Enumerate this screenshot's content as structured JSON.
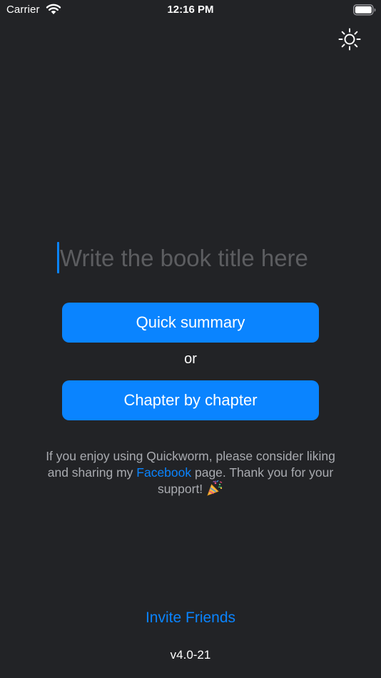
{
  "status_bar": {
    "carrier": "Carrier",
    "time": "12:16 PM",
    "icons": [
      "wifi-icon",
      "battery-icon"
    ]
  },
  "header": {
    "theme_toggle_icon": "sun-icon"
  },
  "main": {
    "title_input": {
      "value": "",
      "placeholder": "Write the book title here"
    },
    "quick_summary_label": "Quick summary",
    "or_label": "or",
    "chapter_label": "Chapter by chapter"
  },
  "support": {
    "text_before": "If you enjoy using Quickworm, please consider liking and sharing my ",
    "link": "Facebook",
    "text_after": " page. Thank you for your support! ",
    "emoji_icon": "party-popper-icon"
  },
  "footer": {
    "invite_label": "Invite Friends",
    "version": "v4.0-21"
  },
  "colors": {
    "background": "#222326",
    "accent": "#0a84ff",
    "placeholder": "#5c5d60",
    "secondary_text": "#a9abb0"
  }
}
